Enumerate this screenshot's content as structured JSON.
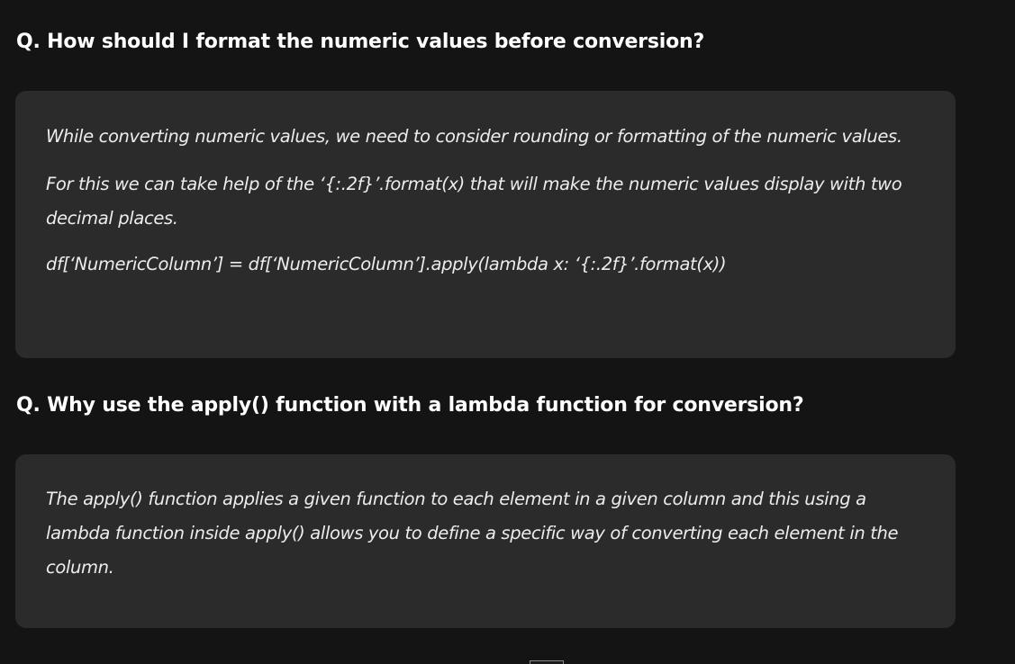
{
  "faq": [
    {
      "question": "Q. How should I format the numeric values before conversion?",
      "answer_paragraphs": [
        "While converting numeric values, we need to consider rounding or formatting of the numeric values.",
        "For this we can take help of the ‘{:.2f}’.format(x) that will make the numeric values display with two decimal places.",
        "df[‘NumericColumn’] = df[‘NumericColumn’].apply(lambda x: ‘{:.2f}’.format(x))"
      ]
    },
    {
      "question": "Q. Why use the apply() function with a lambda function for conversion?",
      "answer_paragraphs": [
        "The apply() function applies a given function to each element in a given column and this using a lambda function inside apply() allows you to define a specific way of converting each element in the column."
      ]
    }
  ],
  "colors": {
    "background": "#141414",
    "card_background": "#2b2b2c",
    "text": "#ececec"
  }
}
